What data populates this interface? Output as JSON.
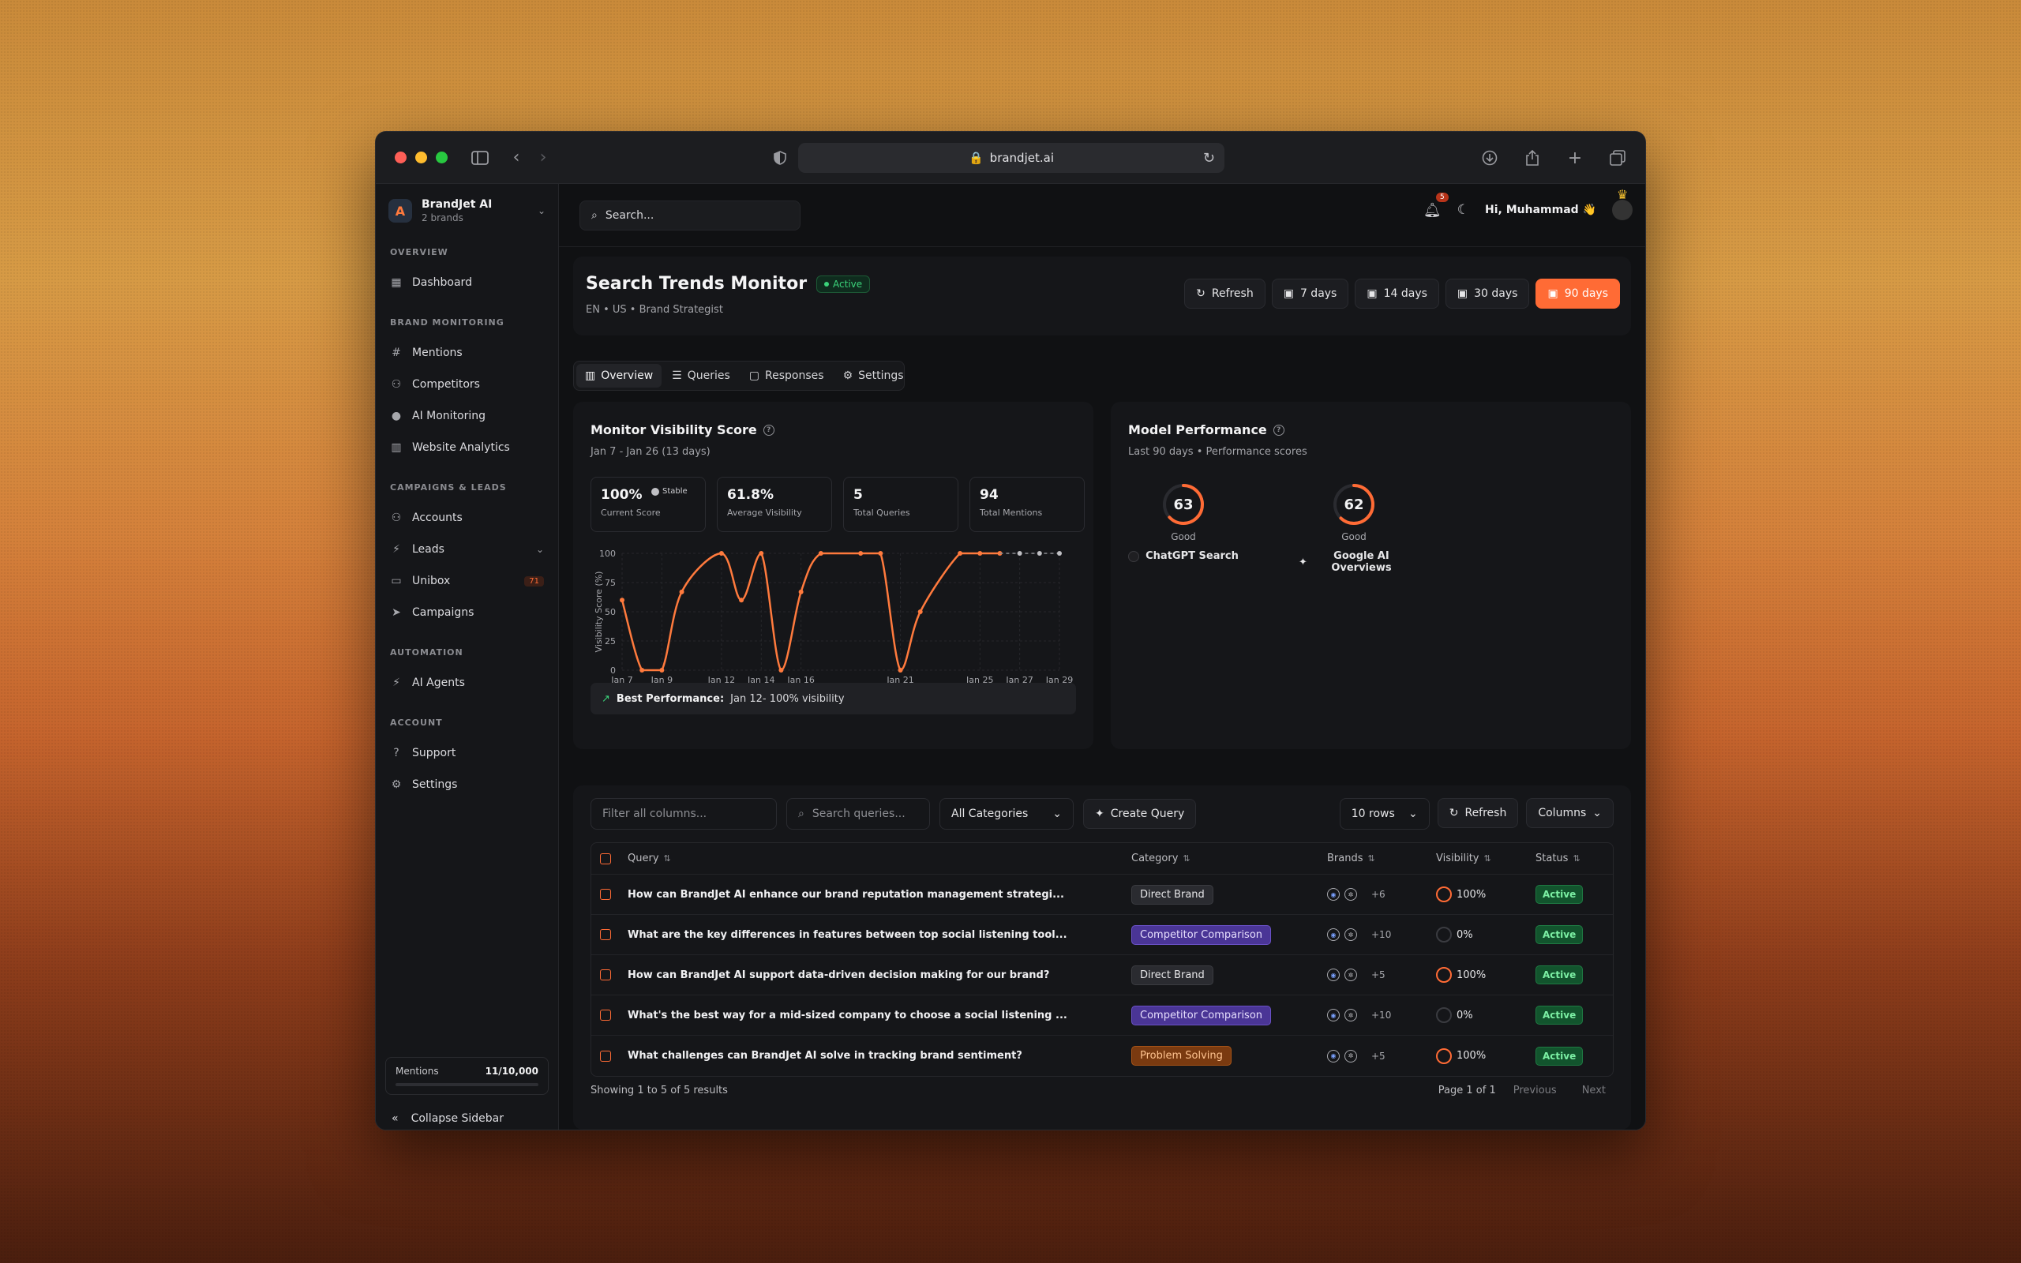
{
  "browser": {
    "url": "brandjet.ai"
  },
  "sidebar": {
    "brand_name": "BrandJet AI",
    "brand_sub": "2 brands",
    "sections": [
      {
        "label": "OVERVIEW",
        "items": [
          {
            "label": "Dashboard",
            "icon": "dashboard-icon"
          }
        ]
      },
      {
        "label": "BRAND MONITORING",
        "items": [
          {
            "label": "Mentions",
            "icon": "hash-icon"
          },
          {
            "label": "Competitors",
            "icon": "users-icon"
          },
          {
            "label": "AI Monitoring",
            "icon": "pin-icon"
          },
          {
            "label": "Website Analytics",
            "icon": "bar-chart-icon"
          }
        ]
      },
      {
        "label": "CAMPAIGNS & LEADS",
        "items": [
          {
            "label": "Accounts",
            "icon": "user-icon"
          },
          {
            "label": "Leads",
            "icon": "bolt-icon"
          },
          {
            "label": "Unibox",
            "icon": "inbox-icon",
            "badge": "71"
          },
          {
            "label": "Campaigns",
            "icon": "send-icon"
          }
        ]
      },
      {
        "label": "AUTOMATION",
        "items": [
          {
            "label": "AI Agents",
            "icon": "bolt-icon"
          }
        ]
      },
      {
        "label": "ACCOUNT",
        "items": [
          {
            "label": "Support",
            "icon": "help-icon"
          },
          {
            "label": "Settings",
            "icon": "gear-icon"
          }
        ]
      }
    ],
    "mentions_label": "Mentions",
    "mentions_value": "11/10,000",
    "collapse_label": "Collapse Sidebar"
  },
  "topbar": {
    "search_placeholder": "Search...",
    "notif_count": "5",
    "greeting": "Hi, Muhammad 👋"
  },
  "header": {
    "title": "Search Trends Monitor",
    "status": "Active",
    "subtitle": "EN • US • Brand Strategist",
    "refresh": "Refresh",
    "ranges": [
      "7 days",
      "14 days",
      "30 days",
      "90 days"
    ],
    "active_range": "90 days"
  },
  "tabs": [
    "Overview",
    "Queries",
    "Responses",
    "Settings"
  ],
  "visibility": {
    "title": "Monitor Visibility Score",
    "subtitle": "Jan 7 - Jan 26 (13 days)",
    "stats": [
      {
        "value": "100%",
        "label": "Current Score",
        "tag": "Stable"
      },
      {
        "value": "61.8%",
        "label": "Average Visibility"
      },
      {
        "value": "5",
        "label": "Total Queries"
      },
      {
        "value": "94",
        "label": "Total Mentions"
      }
    ],
    "best_label": "Best Performance:",
    "best_value": "Jan 12- 100% visibility"
  },
  "chart_data": {
    "type": "line",
    "ylabel": "Visibility Score (%)",
    "ylim": [
      0,
      100
    ],
    "yticks": [
      0,
      25,
      50,
      75,
      100
    ],
    "xticks": [
      "Jan 7",
      "Jan 9",
      "Jan 12",
      "Jan 14",
      "Jan 16",
      "Jan 21",
      "Jan 25",
      "Jan 27",
      "Jan 29"
    ],
    "x": [
      "Jan 7",
      "Jan 8",
      "Jan 9",
      "Jan 10",
      "Jan 12",
      "Jan 13",
      "Jan 14",
      "Jan 15",
      "Jan 16",
      "Jan 17",
      "Jan 19",
      "Jan 20",
      "Jan 21",
      "Jan 22",
      "Jan 24",
      "Jan 25",
      "Jan 26"
    ],
    "values": [
      60,
      0,
      0,
      67,
      100,
      60,
      100,
      0,
      67,
      100,
      100,
      100,
      0,
      50,
      100,
      100,
      100
    ],
    "projection_x": [
      "Jan 26",
      "Jan 27",
      "Jan 28",
      "Jan 29"
    ],
    "projection_values": [
      100,
      100,
      100,
      100
    ]
  },
  "model_perf": {
    "title": "Model Performance",
    "subtitle": "Last 90 days • Performance scores",
    "models": [
      {
        "score": "63",
        "value": 63,
        "label": "Good",
        "name": "ChatGPT Search"
      },
      {
        "score": "62",
        "value": 62,
        "label": "Good",
        "name": "Google AI Overviews"
      }
    ]
  },
  "table": {
    "filter_placeholder": "Filter all columns...",
    "search_placeholder": "Search queries...",
    "category_select": "All Categories",
    "create_label": "Create Query",
    "rows_select": "10 rows",
    "refresh_label": "Refresh",
    "columns_label": "Columns",
    "headers": [
      "Query",
      "Category",
      "Brands",
      "Visibility",
      "Status"
    ],
    "rows": [
      {
        "query": "How can BrandJet AI enhance our brand reputation management strategi...",
        "category": "Direct Brand",
        "cat_type": "direct",
        "more": "+6",
        "visibility": "100%",
        "status": "Active"
      },
      {
        "query": "What are the key differences in features between top social listening tool...",
        "category": "Competitor Comparison",
        "cat_type": "comp",
        "more": "+10",
        "visibility": "0%",
        "status": "Active"
      },
      {
        "query": "How can BrandJet AI support data-driven decision making for our brand?",
        "category": "Direct Brand",
        "cat_type": "direct",
        "more": "+5",
        "visibility": "100%",
        "status": "Active"
      },
      {
        "query": "What's the best way for a mid-sized company to choose a social listening ...",
        "category": "Competitor Comparison",
        "cat_type": "comp",
        "more": "+10",
        "visibility": "0%",
        "status": "Active"
      },
      {
        "query": "What challenges can BrandJet AI solve in tracking brand sentiment?",
        "category": "Problem Solving",
        "cat_type": "prob",
        "more": "+5",
        "visibility": "100%",
        "status": "Active"
      }
    ],
    "showing": "Showing 1 to 5 of 5 results",
    "page_info": "Page 1 of 1",
    "prev": "Previous",
    "next": "Next"
  }
}
